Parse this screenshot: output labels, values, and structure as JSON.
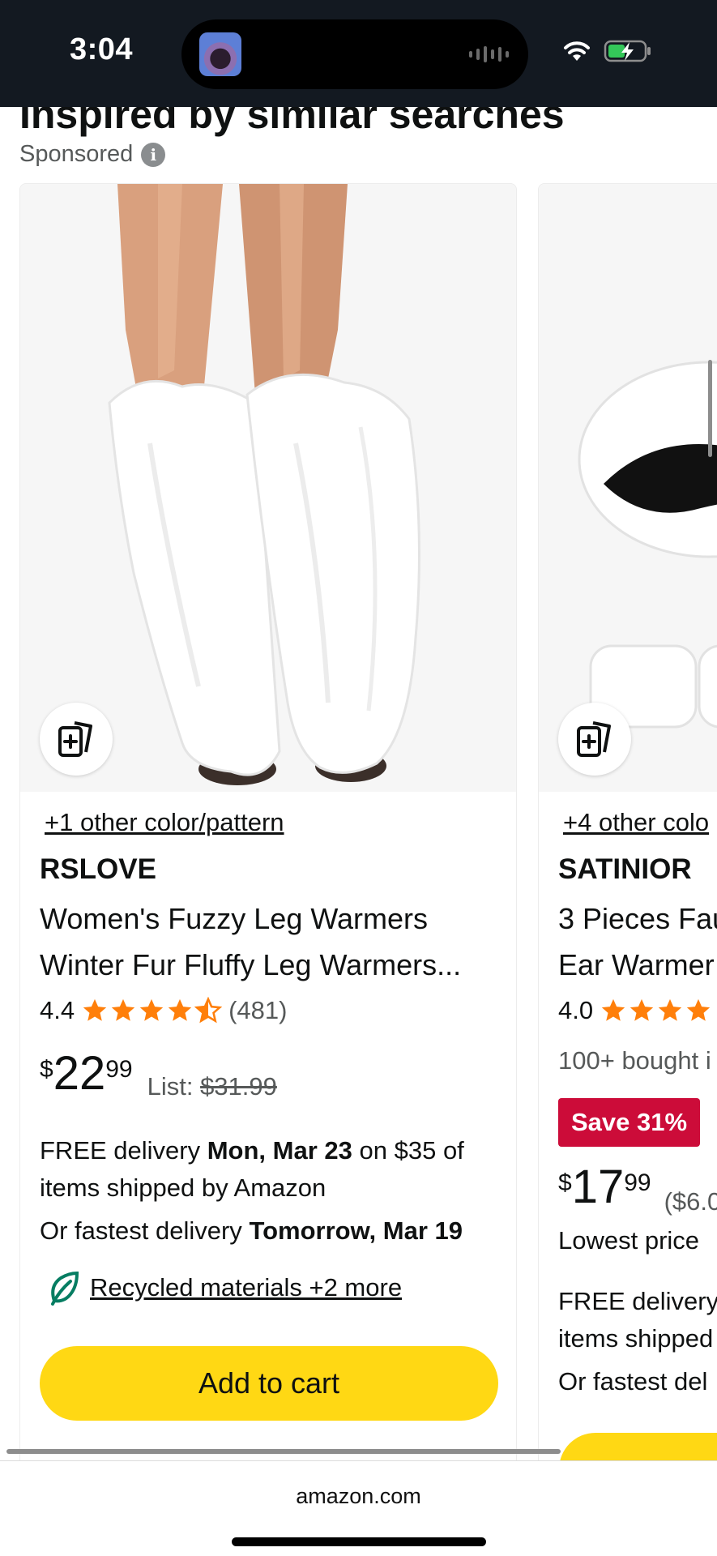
{
  "status_bar": {
    "time": "3:04",
    "icons": [
      "wifi-icon",
      "battery-charging-icon"
    ]
  },
  "section": {
    "heading": "Inspired by similar searches",
    "sponsored_label": "Sponsored",
    "info_icon_glyph": "i"
  },
  "products": [
    {
      "other_colors": "+1 other color/pattern",
      "brand": "RSLOVE",
      "title_line1": "Women's Fuzzy Leg Warmers",
      "title_line2": "Winter Fur Fluffy Leg Warmers...",
      "rating": "4.4",
      "rating_value": 4.4,
      "rating_count": "(481)",
      "price_symbol": "$",
      "price_whole": "22",
      "price_fraction": "99",
      "list_label": "List:",
      "list_price": "$31.99",
      "delivery_prefix": "FREE delivery",
      "delivery_date": "Mon, Mar 23",
      "delivery_suffix": "on $35 of items shipped by Amazon",
      "fastest_prefix": "Or fastest delivery",
      "fastest_date": "Tomorrow, Mar 19",
      "eco_label": "Recycled materials +2 more",
      "add_to_cart": "Add to cart"
    },
    {
      "other_colors": "+4 other colo",
      "brand": "SATINIOR",
      "title_line1": "3 Pieces Fau",
      "title_line2": "Ear Warmer",
      "rating": "4.0",
      "rating_value": 4.0,
      "bought": "100+ bought i",
      "save_badge": "Save 31%",
      "price_symbol": "$",
      "price_whole": "17",
      "price_fraction": "99",
      "unit_price": "($6.0",
      "lowest": "Lowest price",
      "delivery_line1": "FREE delivery",
      "delivery_line2": "items shipped",
      "fastest": "Or fastest del"
    }
  ],
  "bottom_bar": {
    "url": "amazon.com"
  },
  "colors": {
    "status_bar_bg": "#131921",
    "star_orange": "#ff7f0a",
    "add_to_cart_yellow": "#ffd814",
    "save_badge_red": "#cc0c39",
    "eco_green": "#067d62"
  }
}
